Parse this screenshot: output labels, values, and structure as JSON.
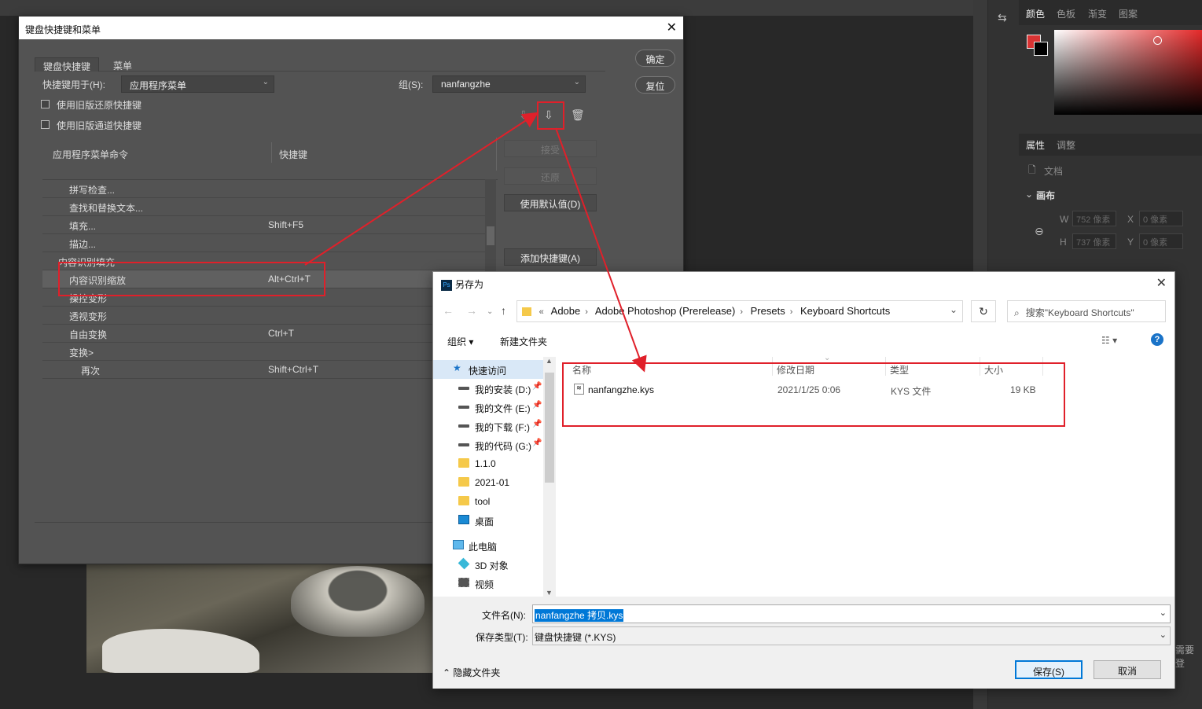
{
  "ps_panel": {
    "tabs": [
      "颜色",
      "色板",
      "渐变",
      "图案"
    ],
    "props_tabs": [
      "属性",
      "调整"
    ],
    "doc_label": "文档",
    "canvas_label": "画布",
    "w_label": "W",
    "w_value": "752 像素",
    "x_label": "X",
    "x_value": "0 像素",
    "h_label": "H",
    "h_value": "737 像素",
    "y_label": "Y",
    "y_value": "0 像素",
    "partial_text": "需要登"
  },
  "shortcuts_dialog": {
    "title": "键盘快捷键和菜单",
    "tabs": [
      "键盘快捷键",
      "菜单"
    ],
    "shortcuts_for_label": "快捷键用于(H):",
    "shortcuts_for_value": "应用程序菜单",
    "set_label": "组(S):",
    "set_value": "nanfangzhe",
    "checkbox1": "使用旧版还原快捷键",
    "checkbox2": "使用旧版通道快捷键",
    "ok": "确定",
    "reset": "复位",
    "accept": "接受",
    "undo": "还原",
    "use_default": "使用默认值(D)",
    "add_shortcut": "添加快捷键(A)",
    "col_command": "应用程序菜单命令",
    "col_shortcut": "快捷键",
    "rows": [
      {
        "name": "拼写检查...",
        "key": "",
        "indent": 1
      },
      {
        "name": "查找和替换文本...",
        "key": "",
        "indent": 1
      },
      {
        "name": "填充...",
        "key": "Shift+F5",
        "indent": 1
      },
      {
        "name": "描边...",
        "key": "",
        "indent": 1
      },
      {
        "name": "内容识别填充",
        "key": "",
        "indent": 0
      },
      {
        "name": "内容识别缩放",
        "key": "Alt+Ctrl+T",
        "indent": 1
      },
      {
        "name": "操控变形",
        "key": "",
        "indent": 1
      },
      {
        "name": "透视变形",
        "key": "",
        "indent": 1
      },
      {
        "name": "自由变换",
        "key": "Ctrl+T",
        "indent": 1
      },
      {
        "name": "变换>",
        "key": "",
        "indent": 1
      },
      {
        "name": "再次",
        "key": "Shift+Ctrl+T",
        "indent": 2
      }
    ],
    "selected_row": 5
  },
  "save_dialog": {
    "title": "另存为",
    "breadcrumb": [
      "Adobe",
      "Adobe Photoshop (Prerelease)",
      "Presets",
      "Keyboard Shortcuts"
    ],
    "search_placeholder": "搜索\"Keyboard Shortcuts\"",
    "organize": "组织 ▾",
    "new_folder": "新建文件夹",
    "sidebar": [
      {
        "label": "快速访问",
        "icon": "star",
        "indent": 0,
        "pin": false
      },
      {
        "label": "我的安装 (D:)",
        "icon": "drive",
        "indent": 1,
        "pin": true
      },
      {
        "label": "我的文件 (E:)",
        "icon": "drive",
        "indent": 1,
        "pin": true
      },
      {
        "label": "我的下载 (F:)",
        "icon": "drive",
        "indent": 1,
        "pin": true
      },
      {
        "label": "我的代码 (G:)",
        "icon": "drive",
        "indent": 1,
        "pin": true
      },
      {
        "label": "1.1.0",
        "icon": "folder",
        "indent": 1,
        "pin": false
      },
      {
        "label": "2021-01",
        "icon": "folder",
        "indent": 1,
        "pin": false
      },
      {
        "label": "tool",
        "icon": "folder",
        "indent": 1,
        "pin": false
      },
      {
        "label": "桌面",
        "icon": "desktop",
        "indent": 1,
        "pin": false
      },
      {
        "label": "此电脑",
        "icon": "pc",
        "indent": 0,
        "pin": false
      },
      {
        "label": "3D 对象",
        "icon": "cube",
        "indent": 1,
        "pin": false
      },
      {
        "label": "视频",
        "icon": "video",
        "indent": 1,
        "pin": false
      }
    ],
    "columns": [
      "名称",
      "修改日期",
      "类型",
      "大小"
    ],
    "files": [
      {
        "name": "nanfangzhe.kys",
        "date": "2021/1/25 0:06",
        "type": "KYS 文件",
        "size": "19 KB"
      }
    ],
    "filename_label": "文件名(N):",
    "filename_value": "nanfangzhe 拷贝.kys",
    "filetype_label": "保存类型(T):",
    "filetype_value": "键盘快捷键 (*.KYS)",
    "hide_folders": "隐藏文件夹",
    "save": "保存(S)",
    "cancel": "取消"
  },
  "colors": {
    "annotation": "#e0202a",
    "accent_blue": "#0078d7",
    "ps_dark": "#535353"
  }
}
